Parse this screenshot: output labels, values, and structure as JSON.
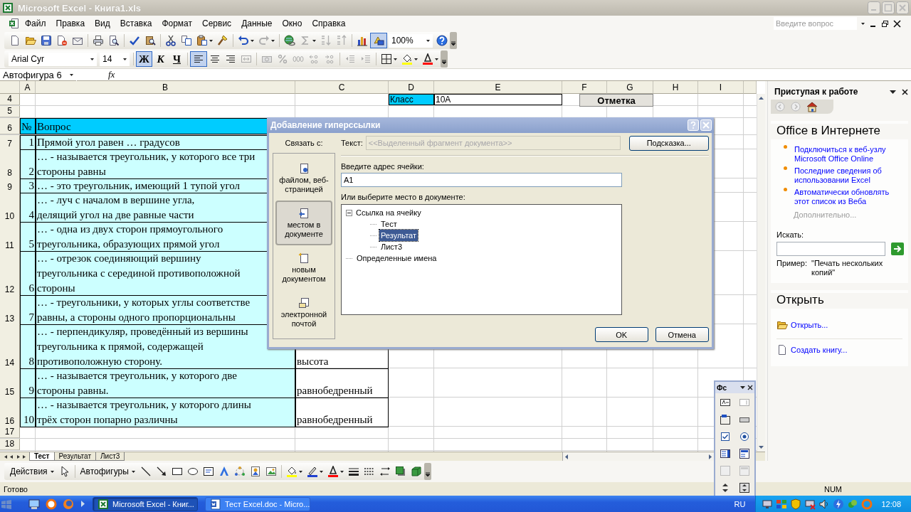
{
  "window": {
    "title": "Microsoft Excel - Книга1.xls"
  },
  "menu": [
    "Файл",
    "Правка",
    "Вид",
    "Вставка",
    "Формат",
    "Сервис",
    "Данные",
    "Окно",
    "Справка"
  ],
  "help_search": {
    "placeholder": "Введите вопрос"
  },
  "drawing_button": {
    "pressed": true
  },
  "zoom": "100%",
  "font": {
    "name": "Arial Cyr",
    "size": "14"
  },
  "styles": [
    {
      "label": "Ж",
      "kind": "bold",
      "pressed": true
    },
    {
      "label": "К",
      "kind": "italic",
      "pressed": false
    },
    {
      "label": "Ч",
      "kind": "underline",
      "pressed": false
    }
  ],
  "alignment": [
    {
      "kind": "left",
      "selected": true
    },
    {
      "kind": "center",
      "selected": false
    },
    {
      "kind": "right",
      "selected": false
    }
  ],
  "name_box": "Автофигура 6",
  "formula_label": "fx",
  "sheet": {
    "columns": [
      "A",
      "B",
      "C",
      "D",
      "E",
      "F",
      "G",
      "H",
      "I"
    ],
    "rows": [
      {
        "kind": "info",
        "number": "4",
        "label": "Класс",
        "value": "10А"
      },
      {
        "kind": "blank",
        "number": "5"
      },
      {
        "kind": "header",
        "number": "6",
        "num": "№",
        "question": "Вопрос"
      },
      {
        "kind": "question",
        "number": "7",
        "num": "1",
        "lines": [
          "Прямой угол равен … градусов"
        ]
      },
      {
        "kind": "question",
        "number": "8",
        "num": "2",
        "lines": [
          "… - называется треугольник, у которого все три",
          "стороны равны"
        ]
      },
      {
        "kind": "question",
        "number": "9",
        "num": "3",
        "lines": [
          "… - это треугольник, имеющий 1 тупой угол"
        ]
      },
      {
        "kind": "question",
        "number": "10",
        "num": "4",
        "lines": [
          "… - луч с началом в вершине угла,",
          "делящий угол на две равные части"
        ]
      },
      {
        "kind": "question",
        "number": "11",
        "num": "5",
        "lines": [
          "… - одна из двух сторон прямоугольного",
          "треугольника, образующих прямой угол"
        ]
      },
      {
        "kind": "question",
        "number": "12",
        "num": "6",
        "lines": [
          "… - отрезок соединяющий вершину",
          "треугольника с серединой противоположной",
          "стороны"
        ]
      },
      {
        "kind": "question",
        "number": "13",
        "num": "7",
        "lines": [
          "… - треугольники, у которых углы соответстве",
          "равны, а стороны одного пропорциональны"
        ]
      },
      {
        "kind": "question",
        "number": "14",
        "num": "8",
        "lines": [
          "… - перпендикуляр, проведённый из вершины",
          "треугольника к прямой, содержащей",
          "противоположную сторону."
        ],
        "answer": "высота"
      },
      {
        "kind": "question",
        "number": "15",
        "num": "9",
        "lines": [
          "… - называется треугольник, у которого две",
          "стороны равны."
        ],
        "answer": "равнобедренный"
      },
      {
        "kind": "question",
        "number": "16",
        "num": "10",
        "lines": [
          "… - называется треугольник, у которого длины",
          "трёх сторон попарно различны"
        ],
        "answer": "равнобедренный"
      },
      {
        "kind": "blank",
        "number": "17"
      },
      {
        "kind": "blank",
        "number": "18"
      }
    ],
    "button": "Отметка",
    "tabs": [
      {
        "label": "Тест",
        "selected": true
      },
      {
        "label": "Результат",
        "selected": false
      },
      {
        "label": "Лист3",
        "selected": false
      }
    ]
  },
  "dialog": {
    "title": "Добавление гиперссылки",
    "link_label": "Связать с:",
    "link_targets": [
      {
        "label": "файлом, веб-страницей",
        "kind": "file",
        "selected": false
      },
      {
        "label": "местом в документе",
        "kind": "place",
        "selected": true
      },
      {
        "label": "новым документом",
        "kind": "new",
        "selected": false
      },
      {
        "label": "электронной почтой",
        "kind": "email",
        "selected": false
      }
    ],
    "text_label": "Текст:",
    "text_value": "<<Выделенный фрагмент документа>>",
    "tip_button": "Подсказка...",
    "address_label": "Введите адрес ячейки:",
    "address_value": "A1",
    "place_label": "Или выберите место в документе:",
    "tree": [
      {
        "label": "Ссылка на ячейку",
        "expanded": true,
        "selected": false,
        "children": [
          {
            "label": "Тест",
            "selected": false
          },
          {
            "label": "Результат",
            "selected": true
          },
          {
            "label": "Лист3",
            "selected": false
          }
        ]
      },
      {
        "label": "Определенные имена",
        "selected": false
      }
    ],
    "buttons": [
      "OK",
      "Отмена"
    ]
  },
  "task_pane": {
    "title": "Приступая к работе",
    "online_title": "Office в Интернете",
    "links": [
      "Подключиться к веб-узлу Microsoft Office Online",
      "Последние сведения об использовании Excel",
      "Автоматически обновлять этот список из Веба"
    ],
    "more": "Дополнительно...",
    "search_label": "Искать:",
    "example_label": "Пример:",
    "example": "\"Печать нескольких копий\"",
    "open_title": "Открыть",
    "open_links": [
      {
        "label": "Открыть...",
        "kind": "open"
      },
      {
        "label": "Создать книгу...",
        "kind": "new"
      }
    ]
  },
  "drawing_toolbar": {
    "actions": "Действия",
    "autoshapes": "Автофигуры"
  },
  "forms_toolbar": {
    "title": "Фс"
  },
  "status_bar": {
    "state": "Готово",
    "num": "NUM"
  },
  "taskbar": {
    "tasks": [
      {
        "label": "Microsoft Excel - Книг...",
        "kind": "excel",
        "selected": true
      },
      {
        "label": "Тест Excel.doc - Micro...",
        "kind": "word",
        "selected": false
      }
    ],
    "language": "RU",
    "clock": "12:08"
  }
}
